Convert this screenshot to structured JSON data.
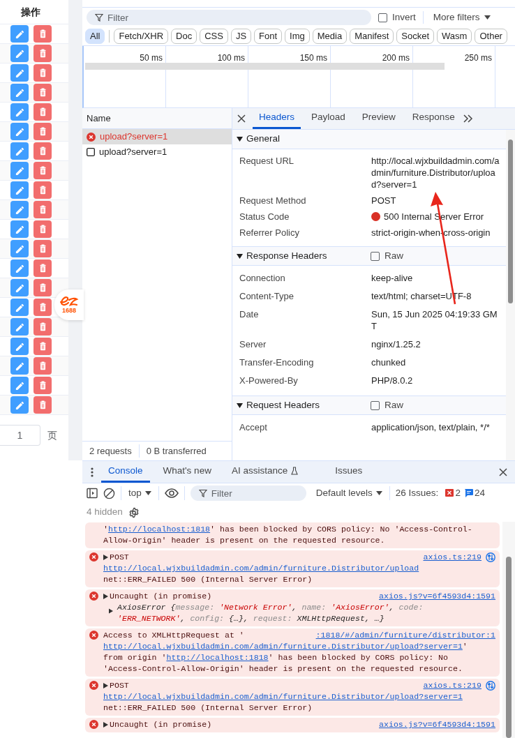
{
  "table": {
    "header": "操作",
    "rows": [
      {
        "kind": "edit_delete"
      },
      {
        "kind": "edit_delete"
      },
      {
        "kind": "edit_delete"
      },
      {
        "kind": "edit_delete"
      },
      {
        "kind": "edit_delete"
      },
      {
        "kind": "edit_delete"
      },
      {
        "kind": "edit_delete"
      },
      {
        "kind": "edit_delete"
      },
      {
        "kind": "edit_delete"
      },
      {
        "kind": "edit_delete"
      },
      {
        "kind": "edit_delete"
      },
      {
        "kind": "edit_delete"
      },
      {
        "kind": "edit_delete"
      },
      {
        "kind": "edit_delete"
      },
      {
        "kind": "edit_delete"
      },
      {
        "kind": "edit_delete"
      },
      {
        "kind": "edit_delete"
      },
      {
        "kind": "edit_delete"
      },
      {
        "kind": "edit_delete"
      },
      {
        "kind": "edit_delete"
      }
    ]
  },
  "pager": {
    "value": "1",
    "unit": "页"
  },
  "floating_badge": {
    "text": "1688"
  },
  "network": {
    "filter": {
      "placeholder": "Filter"
    },
    "invert": {
      "label": "Invert",
      "checked": false
    },
    "more_filters": "More filters",
    "type_filters": [
      {
        "label": "All",
        "selected": true
      },
      {
        "label": "Fetch/XHR",
        "selected": false
      },
      {
        "label": "Doc",
        "selected": false
      },
      {
        "label": "CSS",
        "selected": false
      },
      {
        "label": "JS",
        "selected": false
      },
      {
        "label": "Font",
        "selected": false
      },
      {
        "label": "Img",
        "selected": false
      },
      {
        "label": "Media",
        "selected": false
      },
      {
        "label": "Manifest",
        "selected": false
      },
      {
        "label": "Socket",
        "selected": false
      },
      {
        "label": "Wasm",
        "selected": false
      },
      {
        "label": "Other",
        "selected": false
      }
    ],
    "timeline": {
      "ticks": [
        "50 ms",
        "100 ms",
        "150 ms",
        "200 ms",
        "250 ms"
      ]
    },
    "requests": {
      "header": "Name",
      "items": [
        {
          "name": "upload?server=1",
          "failed": true,
          "selected": true
        },
        {
          "name": "upload?server=1",
          "failed": false,
          "selected": false
        }
      ]
    },
    "summary": [
      "2 requests",
      "0 B transferred"
    ],
    "detail_tabs": [
      {
        "label": "Headers",
        "selected": true
      },
      {
        "label": "Payload",
        "selected": false
      },
      {
        "label": "Preview",
        "selected": false
      },
      {
        "label": "Response",
        "selected": false
      }
    ],
    "sections": [
      {
        "title": "General",
        "expanded": true,
        "rows": [
          {
            "name": "Request URL",
            "value": "http://local.wjxbuildadmin.com/admin/furniture.Distributor/upload?server=1"
          },
          {
            "name": "Request Method",
            "value": "POST"
          },
          {
            "name": "Status Code",
            "value": "500 Internal Server Error",
            "status_dot": true
          },
          {
            "name": "Referrer Policy",
            "value": "strict-origin-when-cross-origin"
          }
        ]
      },
      {
        "title": "Response Headers",
        "expanded": true,
        "raw": {
          "label": "Raw",
          "checked": false
        },
        "rows": [
          {
            "name": "Connection",
            "value": "keep-alive"
          },
          {
            "name": "Content-Type",
            "value": "text/html; charset=UTF-8"
          },
          {
            "name": "Date",
            "value": "Sun, 15 Jun 2025 04:19:33 GMT"
          },
          {
            "name": "Server",
            "value": "nginx/1.25.2"
          },
          {
            "name": "Transfer-Encoding",
            "value": "chunked"
          },
          {
            "name": "X-Powered-By",
            "value": "PHP/8.0.2"
          }
        ]
      },
      {
        "title": "Request Headers",
        "expanded": true,
        "raw": {
          "label": "Raw",
          "checked": false
        },
        "rows": [
          {
            "name": "Accept",
            "value": "application/json, text/plain, */*"
          }
        ]
      }
    ]
  },
  "console": {
    "tabs": [
      {
        "label": "Console",
        "selected": true
      },
      {
        "label": "What's new",
        "selected": false
      },
      {
        "label": "AI assistance",
        "selected": false,
        "experimental": true
      },
      {
        "label": "Issues",
        "selected": false
      }
    ],
    "context": "top",
    "filter_placeholder": "Filter",
    "levels": "Default levels",
    "issues_label": "26 Issues:",
    "error_count": "2",
    "info_count": "24",
    "hidden_label": "4 hidden",
    "messages": [
      {
        "lines": [
          [
            {
              "text": "'",
              "kind": "text"
            },
            {
              "text": "http://localhost:1818",
              "kind": "link"
            },
            {
              "text": "' has been blocked by CORS policy: No 'Access-Control-",
              "kind": "text"
            }
          ],
          [
            {
              "text": "Allow-Origin' header is present on the requested resource.",
              "kind": "text"
            }
          ]
        ]
      },
      {
        "show_icon": true,
        "expandable": true,
        "source": "axios.ts:219",
        "network_icon": true,
        "lines": [
          [
            {
              "text": "POST",
              "kind": "text"
            }
          ],
          [
            {
              "text": "http://local.wjxbuildadmin.com/admin/furniture.Distributor/upload",
              "kind": "link"
            }
          ],
          [
            {
              "text": "net::ERR_FAILED 500 (Internal Server Error)",
              "kind": "text"
            }
          ]
        ]
      },
      {
        "show_icon": true,
        "expandable": true,
        "source": "axios.js?v=6f4593d4:1591",
        "lines": [
          [
            {
              "text": "Uncaught (in promise)",
              "kind": "text"
            }
          ]
        ],
        "object_preview": [
          {
            "text": "AxiosError  {",
            "kind": "object"
          },
          {
            "text": "message: ",
            "kind": "key"
          },
          {
            "text": "'Network Error'",
            "kind": "string"
          },
          {
            "text": ", ",
            "kind": "object"
          },
          {
            "text": "name: ",
            "kind": "key"
          },
          {
            "text": "'AxiosError'",
            "kind": "string"
          },
          {
            "text": ", ",
            "kind": "object"
          },
          {
            "text": "code: ",
            "kind": "key"
          },
          {
            "text": "'ERR_NETWORK'",
            "kind": "string"
          },
          {
            "text": ", ",
            "kind": "object"
          },
          {
            "text": "config: ",
            "kind": "key"
          },
          {
            "text": "{…}",
            "kind": "object"
          },
          {
            "text": ", ",
            "kind": "object"
          },
          {
            "text": "request: ",
            "kind": "key"
          },
          {
            "text": "XMLHttpRequest",
            "kind": "object"
          },
          {
            "text": ",  …}",
            "kind": "object"
          }
        ]
      },
      {
        "show_icon": true,
        "source": ":1818/#/admin/furniture/distributor:1",
        "lines": [
          [
            {
              "text": "Access to XMLHttpRequest at '",
              "kind": "text"
            }
          ],
          [
            {
              "text": "http://local.wjxbuildadmin.com/admin/furniture.Distributor/upload?server=1",
              "kind": "link"
            },
            {
              "text": "'",
              "kind": "text"
            }
          ],
          [
            {
              "text": "from origin '",
              "kind": "text"
            },
            {
              "text": "http://localhost:1818",
              "kind": "link"
            },
            {
              "text": "' has been blocked by CORS policy: No",
              "kind": "text"
            }
          ],
          [
            {
              "text": "'Access-Control-Allow-Origin' header is present on the requested resource.",
              "kind": "text"
            }
          ]
        ]
      },
      {
        "show_icon": true,
        "expandable": true,
        "source": "axios.ts:219",
        "network_icon": true,
        "lines": [
          [
            {
              "text": "POST",
              "kind": "text"
            }
          ],
          [
            {
              "text": "http://local.wjxbuildadmin.com/admin/furniture.Distributor/upload?server=1",
              "kind": "link"
            }
          ],
          [
            {
              "text": "net::ERR_FAILED 500 (Internal Server Error)",
              "kind": "text"
            }
          ]
        ]
      },
      {
        "show_icon": true,
        "expandable": true,
        "source": "axios.js?v=6f4593d4:1591",
        "lines": [
          [
            {
              "text": "Uncaught (in promise)",
              "kind": "text"
            }
          ]
        ]
      }
    ]
  }
}
